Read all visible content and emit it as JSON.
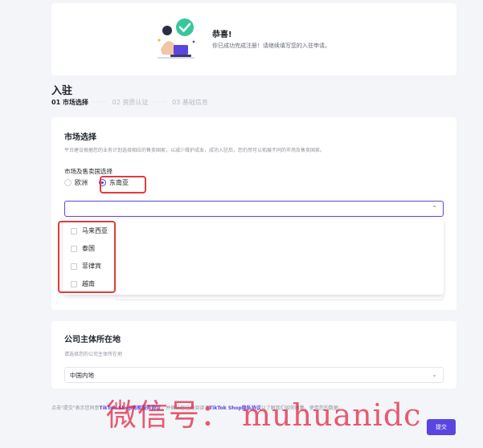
{
  "banner": {
    "title": "恭喜!",
    "subtitle": "你已成功完成注册！请继续填写您的入驻申请。"
  },
  "page": {
    "title": "入驻"
  },
  "steps": [
    {
      "label": "01 市场选择",
      "active": true
    },
    {
      "label": "02 资质认证",
      "active": false
    },
    {
      "label": "03 基础信息",
      "active": false
    }
  ],
  "market": {
    "title": "市场选择",
    "description": "平台建议根据您的业务计划选择相应的售卖国家，以减少维护成本，成功入驻后，您仍然可以拓展不同的市场及售卖国家。",
    "field_label": "市场及售卖国选择",
    "radios": [
      {
        "label": "欧洲",
        "selected": false
      },
      {
        "label": "东南亚",
        "selected": true
      }
    ],
    "select_chevron": "⌃",
    "options": [
      "马来西亚",
      "泰国",
      "菲律宾",
      "越南"
    ]
  },
  "company": {
    "title": "公司主体所在地",
    "description": "请选择您的公司主体所在地",
    "value": "中国内地",
    "chevron": "⌄"
  },
  "footer": {
    "prefix": "点击\"提交\"表示您同意",
    "link1": "TikTok Shop商家服务协议",
    "middle": "，并确认您已经阅读了",
    "link2": "TikTok Shop隐私协议",
    "suffix": "以了解我们如何收集、使用您的数据。"
  },
  "watermark": "微信号： muhuanidc",
  "submit_label": "提交",
  "colors": {
    "accent": "#5b45e0",
    "highlight": "#e23b3b",
    "watermark": "#e11e3c"
  }
}
